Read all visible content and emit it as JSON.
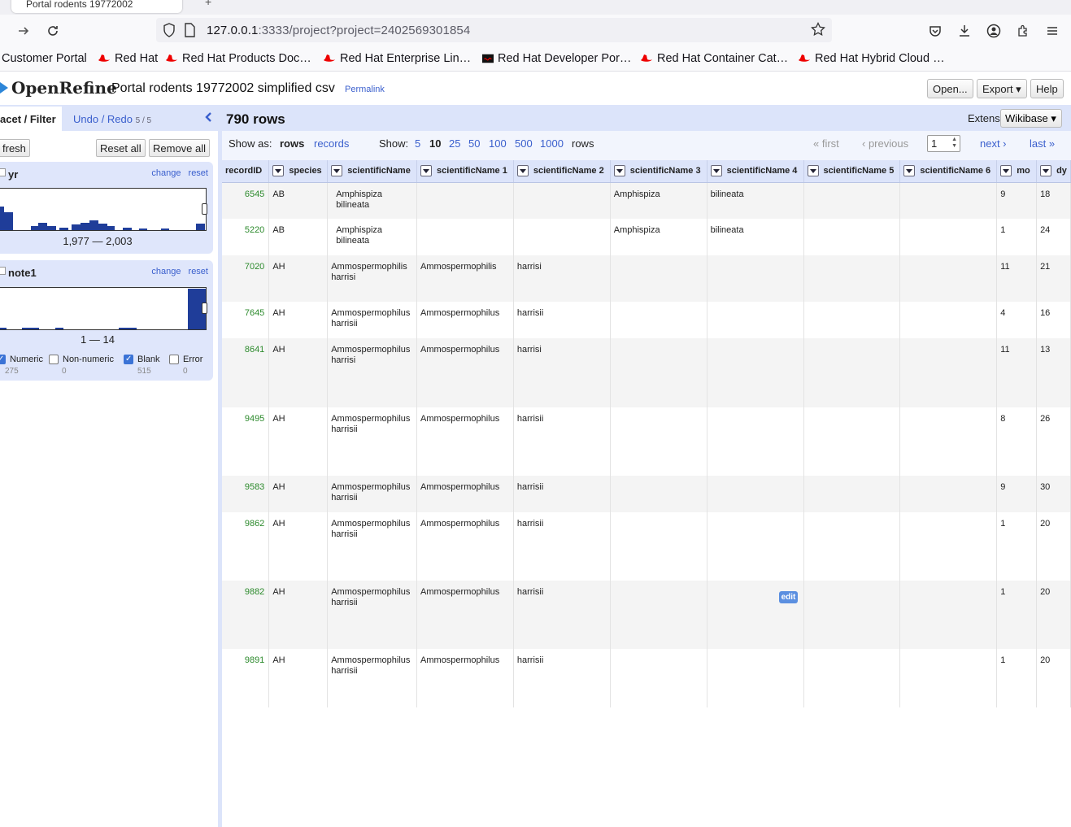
{
  "browser": {
    "tab_title": "Portal rodents 19772002",
    "url_host": "127.0.0.1",
    "url_rest": ":3333/project?project=2402569301854",
    "bookmarks": [
      "Customer Portal",
      "Red Hat",
      "Red Hat Products Doc…",
      "Red Hat Enterprise Lin…",
      "Red Hat Developer Por…",
      "Red Hat Container Cat…",
      "Red Hat Hybrid Cloud …"
    ]
  },
  "app": {
    "logo": "OpenRefine",
    "project_name": "Portal rodents 19772002 simplified csv",
    "permalink": "Permalink",
    "open_label": "Open...",
    "export_label": "Export ▾",
    "help_label": "Help"
  },
  "left": {
    "tab_facet": "acet / Filter",
    "tab_undo": "Undo / Redo",
    "undo_count": "5 / 5",
    "refresh_label": "fresh",
    "reset_all_label": "Reset all",
    "remove_all_label": "Remove all",
    "facets": [
      {
        "title": "yr",
        "change": "change",
        "reset": "reset",
        "range": "1,977 — 2,003"
      },
      {
        "title": "note1",
        "change": "change",
        "reset": "reset",
        "range": "1 — 14"
      }
    ],
    "checkboxes": [
      {
        "label": "Numeric",
        "count": "275",
        "checked": true
      },
      {
        "label": "Non-numeric",
        "count": "0",
        "checked": false
      },
      {
        "label": "Blank",
        "count": "515",
        "checked": true
      },
      {
        "label": "Error",
        "count": "0",
        "checked": false
      }
    ]
  },
  "summary": {
    "rows": "790 rows",
    "extensions_label": "Extensions",
    "wikibase_label": "Wikibase ▾"
  },
  "view": {
    "show_as": "Show as:",
    "rows": "rows",
    "records": "records",
    "show": "Show:",
    "sizes": [
      "5",
      "10",
      "25",
      "50",
      "100",
      "500",
      "1000"
    ],
    "rows_suffix": "rows",
    "first": "« first",
    "previous": "‹ previous",
    "page": "1",
    "next": "next ›",
    "last": "last »"
  },
  "table": {
    "columns": [
      "recordID",
      "species",
      "scientificName",
      "scientificName 1",
      "scientificName 2",
      "scientificName 3",
      "scientificName 4",
      "scientificName 5",
      "scientificName 6",
      "mo",
      "dy"
    ],
    "edit_label": "edit",
    "rows": [
      [
        "6545",
        "AB",
        "Amphispiza bilineata",
        "",
        "",
        "Amphispiza",
        "bilineata",
        "",
        "",
        "9",
        "18"
      ],
      [
        "5220",
        "AB",
        "Amphispiza bilineata",
        "",
        "",
        "Amphispiza",
        "bilineata",
        "",
        "",
        "1",
        "24"
      ],
      [
        "7020",
        "AH",
        "Ammospermophilis harrisi",
        "Ammospermophilis",
        "harrisi",
        "",
        "",
        "",
        "",
        "11",
        "21"
      ],
      [
        "7645",
        "AH",
        "Ammospermophilus harrisii",
        "Ammospermophilus",
        "harrisii",
        "",
        "",
        "",
        "",
        "4",
        "16"
      ],
      [
        "8641",
        "AH",
        "Ammospermophilus harrisi",
        "Ammospermophilus",
        "harrisi",
        "",
        "",
        "",
        "",
        "11",
        "13"
      ],
      [
        "9495",
        "AH",
        "Ammospermophilus harrisii",
        "Ammospermophilus",
        "harrisii",
        "",
        "",
        "",
        "",
        "8",
        "26"
      ],
      [
        "9583",
        "AH",
        "Ammospermophilus harrisii",
        "Ammospermophilus",
        "harrisii",
        "",
        "",
        "",
        "",
        "9",
        "30"
      ],
      [
        "9862",
        "AH",
        "Ammospermophilus harrisii",
        "Ammospermophilus",
        "harrisii",
        "",
        "",
        "",
        "",
        "1",
        "20"
      ],
      [
        "9882",
        "AH",
        "Ammospermophilus harrisii",
        "Ammospermophilus",
        "harrisii",
        "",
        "",
        "",
        "",
        "1",
        "20"
      ],
      [
        "9891",
        "AH",
        "Ammospermophilus harrisii",
        "Ammospermophilus",
        "harrisii",
        "",
        "",
        "",
        "",
        "1",
        "20"
      ]
    ]
  },
  "colors": {
    "accent": "#3a5fcd",
    "panel": "#dce4fa",
    "histogram_bar": "#1f3d99",
    "record_id": "#2c8a2c"
  }
}
